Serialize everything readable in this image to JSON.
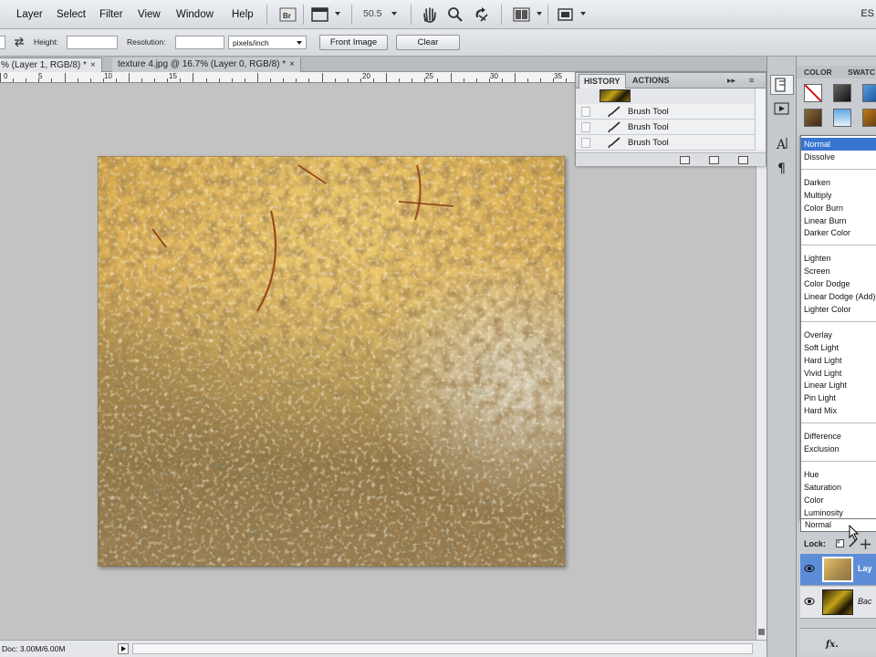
{
  "menubar": {
    "items": [
      "Layer",
      "Select",
      "Filter",
      "View",
      "Window",
      "Help"
    ],
    "zoom": "50.5",
    "workspace": "ES"
  },
  "options": {
    "height_label": "Height:",
    "resolution_label": "Resolution:",
    "units": "pixels/inch",
    "front_image": "Front Image",
    "clear": "Clear"
  },
  "tabs": [
    {
      "label": "% (Layer 1, RGB/8) *",
      "active": true
    },
    {
      "label": "texture 4.jpg @ 16.7% (Layer 0, RGB/8) *",
      "active": false
    }
  ],
  "ruler": {
    "labels": [
      "0",
      "5",
      "10",
      "15",
      "20",
      "25",
      "30",
      "35"
    ]
  },
  "history": {
    "tab_active": "HISTORY",
    "tab_other": "ACTIONS",
    "items": [
      "Brush Tool",
      "Brush Tool",
      "Brush Tool"
    ]
  },
  "color_panel": {
    "tab_active": "COLOR",
    "tab_other": "SWATC"
  },
  "blend_modes": {
    "groups": [
      [
        "Normal",
        "Dissolve"
      ],
      [
        "Darken",
        "Multiply",
        "Color Burn",
        "Linear Burn",
        "Darker Color"
      ],
      [
        "Lighten",
        "Screen",
        "Color Dodge",
        "Linear Dodge (Add)",
        "Lighter Color"
      ],
      [
        "Overlay",
        "Soft Light",
        "Hard Light",
        "Vivid Light",
        "Linear Light",
        "Pin Light",
        "Hard Mix"
      ],
      [
        "Difference",
        "Exclusion"
      ],
      [
        "Hue",
        "Saturation",
        "Color",
        "Luminosity"
      ]
    ],
    "selected": "Normal",
    "current": "Normal"
  },
  "layers": {
    "lock_label": "Lock:",
    "items": [
      {
        "name": "Lay",
        "selected": true
      },
      {
        "name": "Bac",
        "selected": false
      }
    ],
    "fx": "fx."
  },
  "status": {
    "doc": "Doc: 3.00M/6.00M"
  },
  "colors": {
    "selection": "#3874d0",
    "layer_selected": "#5d8dd6"
  }
}
